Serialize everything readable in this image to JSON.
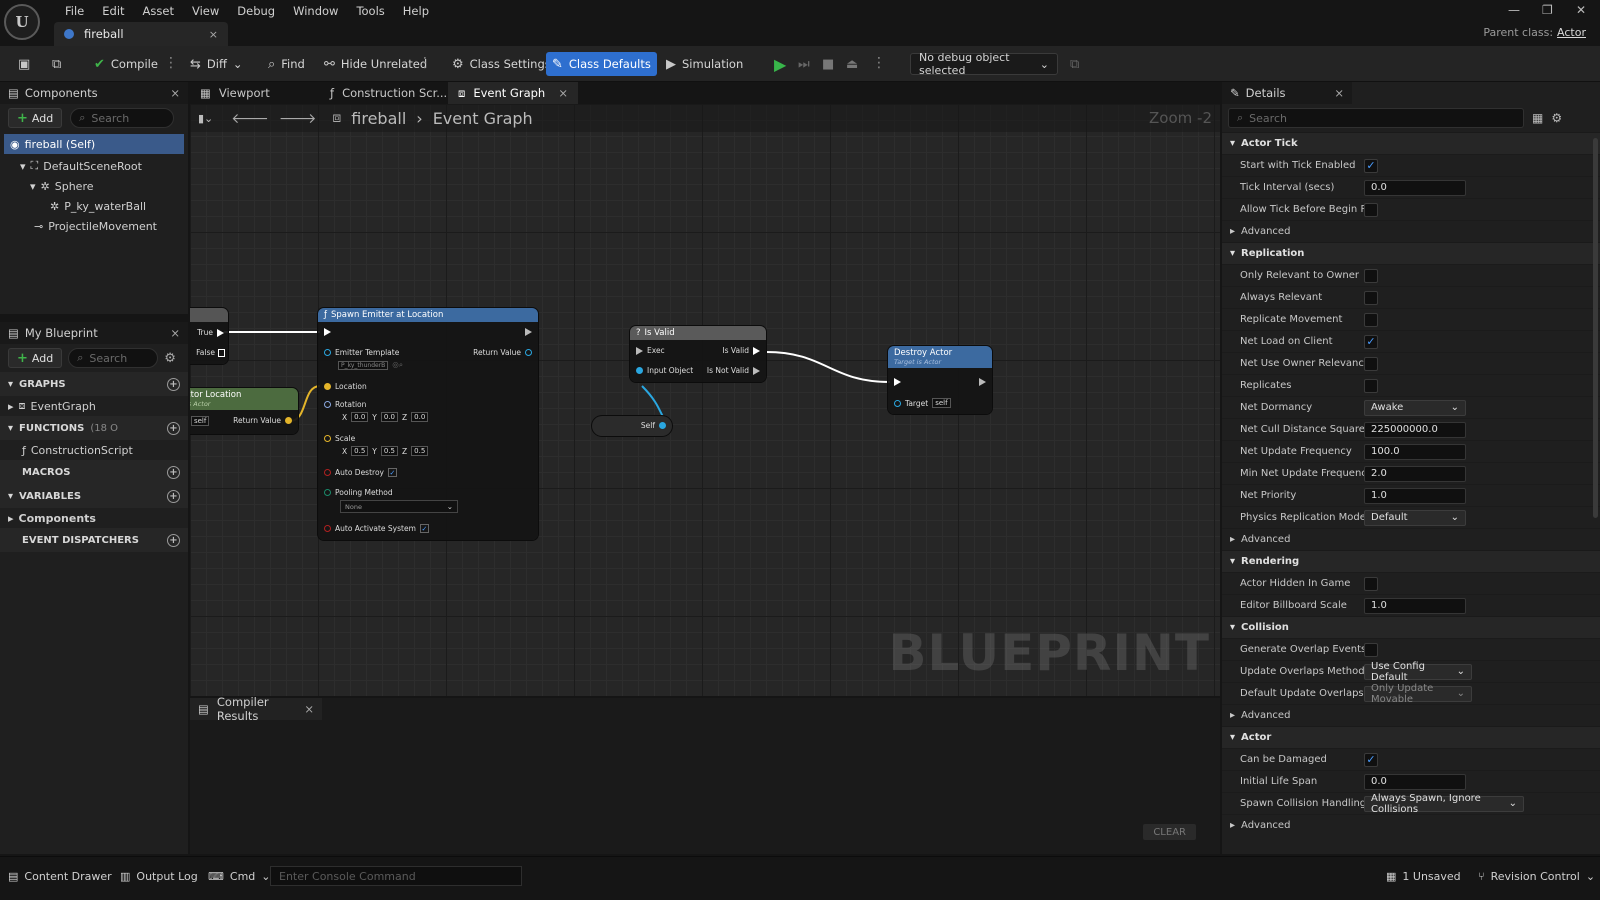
{
  "menu": [
    "File",
    "Edit",
    "Asset",
    "View",
    "Debug",
    "Window",
    "Tools",
    "Help"
  ],
  "document_tab": "fireball",
  "parent_class": {
    "label": "Parent class:",
    "value": "Actor"
  },
  "toolbar": {
    "compile": "Compile",
    "diff": "Diff",
    "find": "Find",
    "hide_unrelated": "Hide Unrelated",
    "class_settings": "Class Settings",
    "class_defaults": "Class Defaults",
    "simulation": "Simulation",
    "debug_object": "No debug object selected"
  },
  "components": {
    "title": "Components",
    "add": "Add",
    "search_placeholder": "Search",
    "items": [
      "fireball (Self)",
      "DefaultSceneRoot",
      "Sphere",
      "P_ky_waterBall",
      "ProjectileMovement"
    ]
  },
  "my_blueprint": {
    "title": "My Blueprint",
    "add": "Add",
    "search_placeholder": "Search",
    "graphs": "GRAPHS",
    "event_graph": "EventGraph",
    "functions": "FUNCTIONS",
    "functions_count": "(18 O",
    "construction_script": "ConstructionScript",
    "macros": "MACROS",
    "variables": "VARIABLES",
    "components_cat": "Components",
    "event_dispatchers": "EVENT DISPATCHERS"
  },
  "graph_tabs": [
    "Viewport",
    "Construction Scr...",
    "Event Graph"
  ],
  "breadcrumb": {
    "root": "fireball",
    "current": "Event Graph"
  },
  "zoom": "Zoom -2",
  "watermark": "BLUEPRINT",
  "nodes": {
    "branch": {
      "true": "True",
      "false": "False"
    },
    "get_location": {
      "title": "ctor Location",
      "subtitle": "is Actor",
      "target_val": "self",
      "return": "Return Value"
    },
    "spawn": {
      "title": "Spawn Emitter at Location",
      "emitter_template": "Emitter Template",
      "emitter_value": "P_ky_thunderB",
      "return": "Return Value",
      "location": "Location",
      "rotation": "Rotation",
      "rot_vals": [
        "0.0",
        "0.0",
        "0.0"
      ],
      "scale": "Scale",
      "scale_vals": [
        "0.5",
        "0.5",
        "0.5"
      ],
      "auto_destroy": "Auto Destroy",
      "pooling": "Pooling Method",
      "pooling_val": "None",
      "auto_activate": "Auto Activate System"
    },
    "is_valid": {
      "title": "Is Valid",
      "exec": "Exec",
      "is_valid": "Is Valid",
      "input": "Input Object",
      "not_valid": "Is Not Valid"
    },
    "self": "Self",
    "destroy": {
      "title": "Destroy Actor",
      "subtitle": "Target is Actor",
      "target": "Target",
      "target_val": "self"
    }
  },
  "compiler": {
    "title": "Compiler Results",
    "clear": "CLEAR"
  },
  "details": {
    "title": "Details",
    "search_placeholder": "Search",
    "sections": [
      {
        "name": "Actor Tick",
        "rows": [
          {
            "label": "Start with Tick Enabled",
            "type": "check",
            "checked": true
          },
          {
            "label": "Tick Interval (secs)",
            "type": "text",
            "value": "0.0"
          },
          {
            "label": "Allow Tick Before Begin P...",
            "type": "check",
            "checked": false
          }
        ],
        "advanced": "Advanced"
      },
      {
        "name": "Replication",
        "rows": [
          {
            "label": "Only Relevant to Owner",
            "type": "check",
            "checked": false
          },
          {
            "label": "Always Relevant",
            "type": "check",
            "checked": false
          },
          {
            "label": "Replicate Movement",
            "type": "check",
            "checked": false
          },
          {
            "label": "Net Load on Client",
            "type": "check",
            "checked": true
          },
          {
            "label": "Net Use Owner Relevancy",
            "type": "check",
            "checked": false
          },
          {
            "label": "Replicates",
            "type": "check",
            "checked": false
          },
          {
            "label": "Net Dormancy",
            "type": "drop",
            "value": "Awake"
          },
          {
            "label": "Net Cull Distance Squared",
            "type": "text",
            "value": "225000000.0"
          },
          {
            "label": "Net Update Frequency",
            "type": "text",
            "value": "100.0"
          },
          {
            "label": "Min Net Update Frequency",
            "type": "text",
            "value": "2.0"
          },
          {
            "label": "Net Priority",
            "type": "text",
            "value": "1.0"
          },
          {
            "label": "Physics Replication Mode",
            "type": "drop",
            "value": "Default"
          }
        ],
        "advanced": "Advanced"
      },
      {
        "name": "Rendering",
        "rows": [
          {
            "label": "Actor Hidden In Game",
            "type": "check",
            "checked": false
          },
          {
            "label": "Editor Billboard Scale",
            "type": "text",
            "value": "1.0"
          }
        ]
      },
      {
        "name": "Collision",
        "rows": [
          {
            "label": "Generate Overlap Events...",
            "type": "check",
            "checked": false
          },
          {
            "label": "Update Overlaps Method...",
            "type": "drop",
            "value": "Use Config Default"
          },
          {
            "label": "Default Update Overlaps...",
            "type": "drop",
            "value": "Only Update Movable",
            "dim": true
          }
        ],
        "advanced": "Advanced"
      },
      {
        "name": "Actor",
        "rows": [
          {
            "label": "Can be Damaged",
            "type": "check",
            "checked": true
          },
          {
            "label": "Initial Life Span",
            "type": "text",
            "value": "0.0"
          },
          {
            "label": "Spawn Collision Handling...",
            "type": "drop",
            "value": "Always Spawn, Ignore Collisions",
            "wide": true
          }
        ],
        "advanced": "Advanced"
      }
    ]
  },
  "statusbar": {
    "content_drawer": "Content Drawer",
    "output_log": "Output Log",
    "cmd": "Cmd",
    "console_placeholder": "Enter Console Command",
    "unsaved": "1 Unsaved",
    "revision": "Revision Control"
  }
}
